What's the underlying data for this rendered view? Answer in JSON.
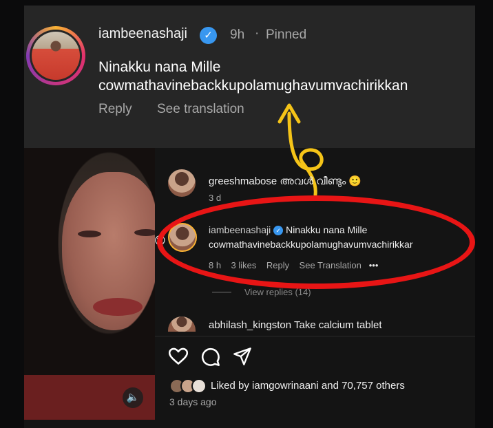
{
  "pinned_comment": {
    "username": "iambeenashaji",
    "time": "9h",
    "separator": "·",
    "pinned_label": "Pinned",
    "text": "Ninakku nana Mille cowmathavinebackkupolamughavumvachirikkan",
    "reply_label": "Reply",
    "translation_label": "See translation"
  },
  "comments": [
    {
      "username": "greeshmabose",
      "text": "അവൾ വീണ്ടും 🙂",
      "time": "3 d"
    },
    {
      "username": "iambeenashaji",
      "text_line1": "Ninakku nana Mille",
      "text_line2": "cowmathavinebackkupolamughavumvachirikkar",
      "time": "8 h",
      "likes": "3 likes",
      "reply_label": "Reply",
      "translation_label": "See Translation",
      "more": "•••"
    },
    {
      "view_replies": "View replies (14)"
    },
    {
      "username": "abhilash_kingston",
      "text": "Take calcium tablet"
    }
  ],
  "post": {
    "liked_by_text": "Liked by iamgowrinaani and 70,757 others",
    "posted": "3 days ago"
  },
  "icons": {
    "like": "heart-icon",
    "comment": "comment-icon",
    "share": "send-icon",
    "mute": "speaker-icon",
    "verified": "verified-badge-icon"
  },
  "colors": {
    "verified_blue": "#3897f0",
    "annotation_red": "#e81515",
    "annotation_yellow": "#f5c418"
  }
}
